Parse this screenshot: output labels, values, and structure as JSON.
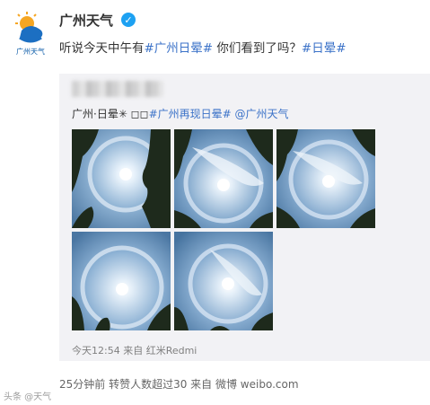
{
  "account": {
    "name": "广州天气",
    "logo_caption": "广州天气"
  },
  "post": {
    "text_before": "听说今天中午有",
    "tag1": "#广州日晕#",
    "text_middle": " 你们看到了吗？",
    "tag2": "#日晕#"
  },
  "repost": {
    "text_prefix": "广州·日晕✳︎ ◻︎◻︎",
    "tag": "#广州再现日晕#",
    "mention": " @广州天气",
    "meta": "今天12:54 来自 红米Redmi",
    "photo_count": 5
  },
  "footer": {
    "text": "25分钟前 转赞人数超过30 来自 微博 weibo.com"
  },
  "watermark": "头条 @天气"
}
